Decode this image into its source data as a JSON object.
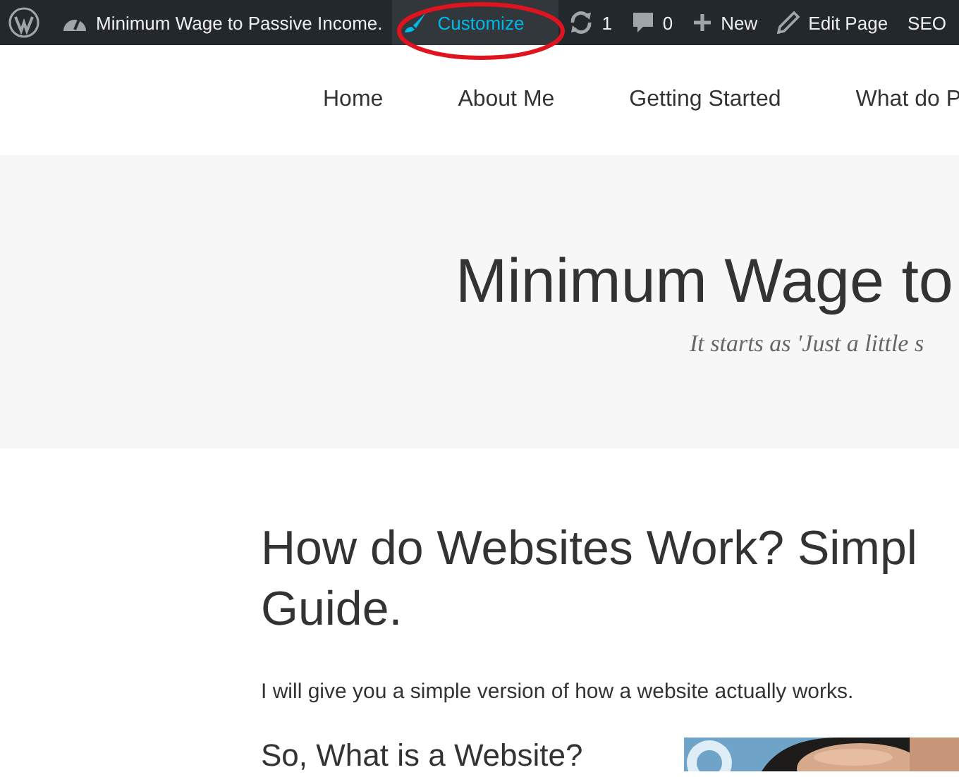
{
  "admin_bar": {
    "items": [
      {
        "kind": "wp-logo",
        "active": false
      },
      {
        "kind": "dashboard",
        "label": "Minimum Wage to Passive Income.",
        "active": false
      },
      {
        "kind": "brush",
        "label": "Customize",
        "active": true
      },
      {
        "kind": "updates",
        "label": "1",
        "active": false
      },
      {
        "kind": "comments",
        "label": "0",
        "active": false
      },
      {
        "kind": "plus",
        "label": "New",
        "active": false
      },
      {
        "kind": "pencil",
        "label": "Edit Page",
        "active": false
      },
      {
        "kind": "text",
        "label": "SEO",
        "active": false
      }
    ]
  },
  "annotation": {
    "kind": "ellipse",
    "color": "#e0141e"
  },
  "nav": {
    "items": [
      "Home",
      "About Me",
      "Getting Started",
      "What do P"
    ]
  },
  "hero": {
    "title": "Minimum Wage to",
    "tagline": "It starts as 'Just a little s"
  },
  "post": {
    "title_lines": [
      "How do Websites Work? Simpl",
      "Guide."
    ],
    "intro": "I will give you a simple version of how a website actually works.",
    "subheading": "So, What is a Website?"
  }
}
